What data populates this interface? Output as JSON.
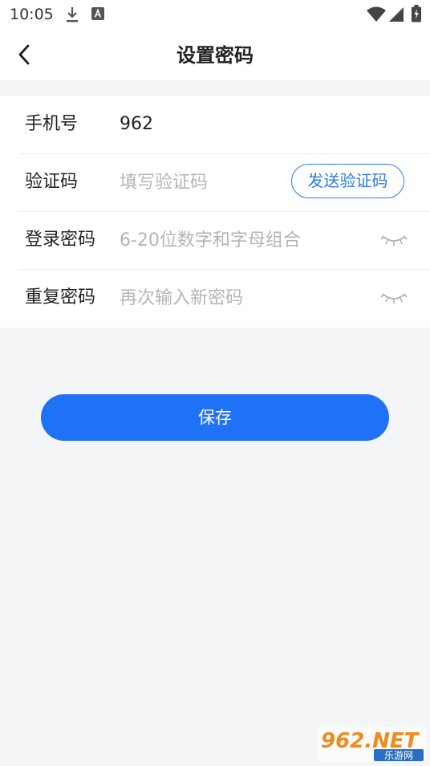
{
  "status_bar": {
    "time": "10:05",
    "icons": [
      "download-icon",
      "a-notification-icon",
      "wifi-icon",
      "cellular-signal-icon",
      "battery-charging-icon"
    ]
  },
  "header": {
    "title": "设置密码",
    "back_icon": "chevron-left-icon"
  },
  "form": {
    "phone": {
      "label": "手机号",
      "value": "962"
    },
    "verification_code": {
      "label": "验证码",
      "placeholder": "填写验证码",
      "send_button": "发送验证码"
    },
    "login_password": {
      "label": "登录密码",
      "placeholder": "6-20位数字和字母组合",
      "toggle_icon": "eye-closed-icon"
    },
    "repeat_password": {
      "label": "重复密码",
      "placeholder": "再次输入新密码",
      "toggle_icon": "eye-closed-icon"
    }
  },
  "actions": {
    "save_label": "保存"
  },
  "watermark": {
    "top": "962.NET",
    "bottom": "乐游网"
  },
  "colors": {
    "accent": "#1f72f5",
    "send_border": "#2f7be6",
    "background": "#f4f5f7",
    "placeholder": "#b5b5b5"
  }
}
